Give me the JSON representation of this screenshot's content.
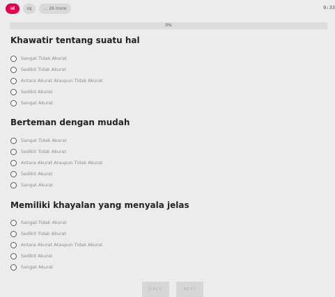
{
  "nav": {
    "pills": [
      "id",
      "sq",
      "... 26 more"
    ],
    "timer": "0:33"
  },
  "progress": {
    "label": "0%",
    "value": 0
  },
  "questions": [
    {
      "title": "Khawatir tentang suatu hal",
      "options": [
        "Sangat Tidak Akurat",
        "Sedikit Tidak Akurat",
        "Antara Akurat Ataupun Tidak Akurat",
        "Sedikit Akurat",
        "Sangat Akurat"
      ]
    },
    {
      "title": "Berteman dengan mudah",
      "options": [
        "Sangat Tidak Akurat",
        "Sedikit Tidak Akurat",
        "Antara Akurat Ataupun Tidak Akurat",
        "Sedikit Akurat",
        "Sangat Akurat"
      ]
    },
    {
      "title": "Memiliki khayalan yang menyala jelas",
      "options": [
        "Sangat Tidak Akurat",
        "Sedikit Tidak Akurat",
        "Antara Akurat Ataupun Tidak Akurat",
        "Sedikit Akurat",
        "Sangat Akurat"
      ]
    }
  ],
  "buttons": {
    "back": "BACK",
    "next": "NEXT"
  },
  "colors": {
    "accent": "#e6004c",
    "background": "#ececec"
  }
}
